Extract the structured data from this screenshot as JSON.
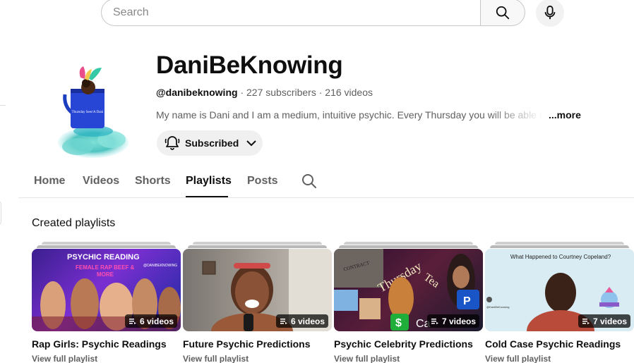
{
  "search": {
    "placeholder": "Search"
  },
  "channel": {
    "name": "DaniBeKnowing",
    "handle": "@danibeknowing",
    "subscribers": "227 subscribers",
    "videos": "216 videos",
    "separator": "·",
    "description": "My name is Dani and I am a medium, intuitive psychic. Every Thursday you will be able to",
    "more_label": "...more",
    "subscribe_label": "Subscribed",
    "avatar_caption": "Thursday Seer/A Dani"
  },
  "tabs": [
    {
      "label": "Home"
    },
    {
      "label": "Videos"
    },
    {
      "label": "Shorts"
    },
    {
      "label": "Playlists"
    },
    {
      "label": "Posts"
    }
  ],
  "active_tab": "Playlists",
  "section_title": "Created playlists",
  "playlists": [
    {
      "title": "Rap Girls: Psychic Readings",
      "count": "6 videos",
      "link": "View full playlist",
      "thumb_text": [
        "PSYCHIC READING",
        "FEMALE RAP BEEF &",
        "MORE",
        "@DANIBEKNOWING"
      ]
    },
    {
      "title": "Future Psychic Predictions",
      "count": "6 videos",
      "link": "View full playlist"
    },
    {
      "title": "Psychic Celebrity Predictions",
      "count": "7 videos",
      "link": "View full playlist",
      "thumb_text": [
        "Thursday",
        "Tea",
        "CONTRACT",
        "Ca"
      ]
    },
    {
      "title": "Cold Case Psychic Readings",
      "count": "7 videos",
      "link": "View full playlist",
      "thumb_text": [
        "What Happened to Courtney Copeland?",
        "@DaniBeKnowing"
      ]
    }
  ],
  "colors": {
    "accent": "#0f0f0f",
    "secondary_text": "#606060",
    "chip_bg": "#f0f0f0"
  },
  "icons": [
    "search-icon",
    "mic-icon",
    "bell-icon",
    "chevron-down-icon",
    "playlist-icon"
  ]
}
